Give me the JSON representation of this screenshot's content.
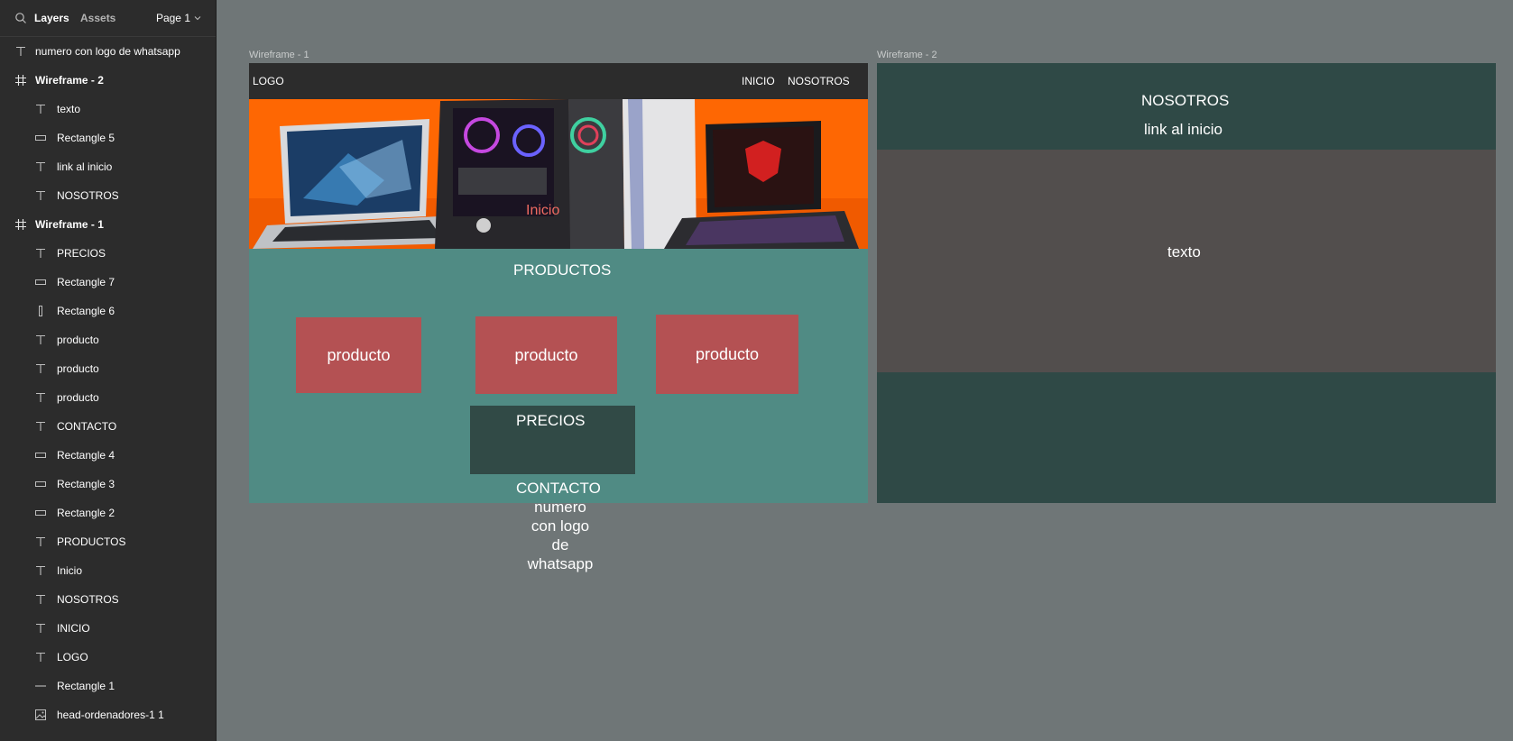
{
  "sidebar": {
    "tabs": {
      "layers": "Layers",
      "assets": "Assets"
    },
    "page": "Page 1",
    "layers": [
      {
        "label": "numero con logo de whatsapp",
        "type": "text",
        "level": 0
      },
      {
        "label": "Wireframe - 2",
        "type": "frame",
        "level": 0
      },
      {
        "label": "texto",
        "type": "text",
        "level": 1
      },
      {
        "label": "Rectangle 5",
        "type": "rect",
        "level": 1
      },
      {
        "label": "link al inicio",
        "type": "text",
        "level": 1
      },
      {
        "label": "NOSOTROS",
        "type": "text",
        "level": 1
      },
      {
        "label": "Wireframe - 1",
        "type": "frame",
        "level": 0
      },
      {
        "label": "PRECIOS",
        "type": "text",
        "level": 1
      },
      {
        "label": "Rectangle 7",
        "type": "rect",
        "level": 1
      },
      {
        "label": "Rectangle 6",
        "type": "vrect",
        "level": 1
      },
      {
        "label": "producto",
        "type": "text",
        "level": 1
      },
      {
        "label": "producto",
        "type": "text",
        "level": 1
      },
      {
        "label": "producto",
        "type": "text",
        "level": 1
      },
      {
        "label": "CONTACTO",
        "type": "text",
        "level": 1
      },
      {
        "label": "Rectangle 4",
        "type": "rect",
        "level": 1
      },
      {
        "label": "Rectangle 3",
        "type": "rect",
        "level": 1
      },
      {
        "label": "Rectangle 2",
        "type": "rect",
        "level": 1
      },
      {
        "label": "PRODUCTOS",
        "type": "text",
        "level": 1
      },
      {
        "label": "Inicio",
        "type": "text",
        "level": 1
      },
      {
        "label": "NOSOTROS",
        "type": "text",
        "level": 1
      },
      {
        "label": "INICIO",
        "type": "text",
        "level": 1
      },
      {
        "label": "LOGO",
        "type": "text",
        "level": 1
      },
      {
        "label": "Rectangle 1",
        "type": "line",
        "level": 1
      },
      {
        "label": "head-ordenadores-1 1",
        "type": "image",
        "level": 1
      }
    ]
  },
  "canvas": {
    "wf1": {
      "label": "Wireframe - 1",
      "logo": "LOGO",
      "nav_inicio": "INICIO",
      "nav_nosotros": "NOSOTROS",
      "hero_text": "Inicio",
      "productos": "PRODUCTOS",
      "producto_1": "producto",
      "producto_2": "producto",
      "producto_3": "producto",
      "precios": "PRECIOS",
      "contacto": "CONTACTO",
      "whatsapp_l1": "numero",
      "whatsapp_l2": "con logo",
      "whatsapp_l3": "de",
      "whatsapp_l4": "whatsapp"
    },
    "wf2": {
      "label": "Wireframe - 2",
      "nosotros": "NOSOTROS",
      "link": "link al inicio",
      "texto": "texto"
    }
  },
  "colors": {
    "canvas_bg": "#6f7677",
    "teal": "#508b84",
    "dark_teal": "#2f4946",
    "product_red": "#b45153",
    "hero_orange": "#fe6703"
  }
}
